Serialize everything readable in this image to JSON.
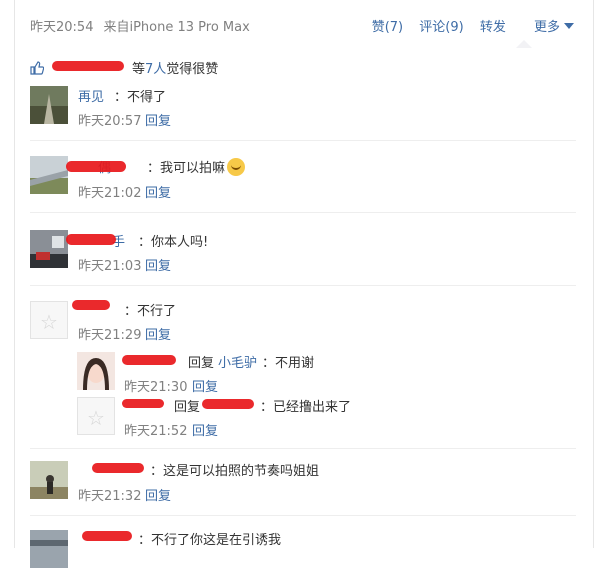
{
  "meta": {
    "time": "昨天20:54",
    "source": "来自iPhone 13 Pro Max"
  },
  "actions": {
    "like": "赞(7)",
    "comment": "评论(9)",
    "repost": "转发",
    "more": "更多"
  },
  "likes": {
    "suffix_prefix": "等",
    "count_link": "7人",
    "suffix": "觉得很赞"
  },
  "comments": [
    {
      "name": "再见",
      "text": "：不得了",
      "time": "昨天20:57",
      "reply": "回复"
    },
    {
      "name": "偶",
      "text": "：我可以拍嘛",
      "time": "昨天21:02",
      "reply": "回复"
    },
    {
      "name": "手",
      "text": "：你本人吗!",
      "time": "昨天21:03",
      "reply": "回复"
    },
    {
      "name": "",
      "text": "：不行了",
      "time": "昨天21:29",
      "reply": "回复"
    },
    {
      "name": "",
      "text": "：这是可以拍照的节奏吗姐姐",
      "time": "昨天21:32",
      "reply": "回复"
    },
    {
      "name": "",
      "text": "：不行了你这是在引诱我",
      "time": "",
      "reply": ""
    }
  ],
  "replies": [
    {
      "reply_word": "回复",
      "target": "小毛驴",
      "text": "：不用谢",
      "time": "昨天21:30",
      "reply": "回复"
    },
    {
      "reply_word": "回复",
      "target": "",
      "text": "：已经撸出来了",
      "time": "昨天21:52",
      "reply": "回复"
    }
  ]
}
